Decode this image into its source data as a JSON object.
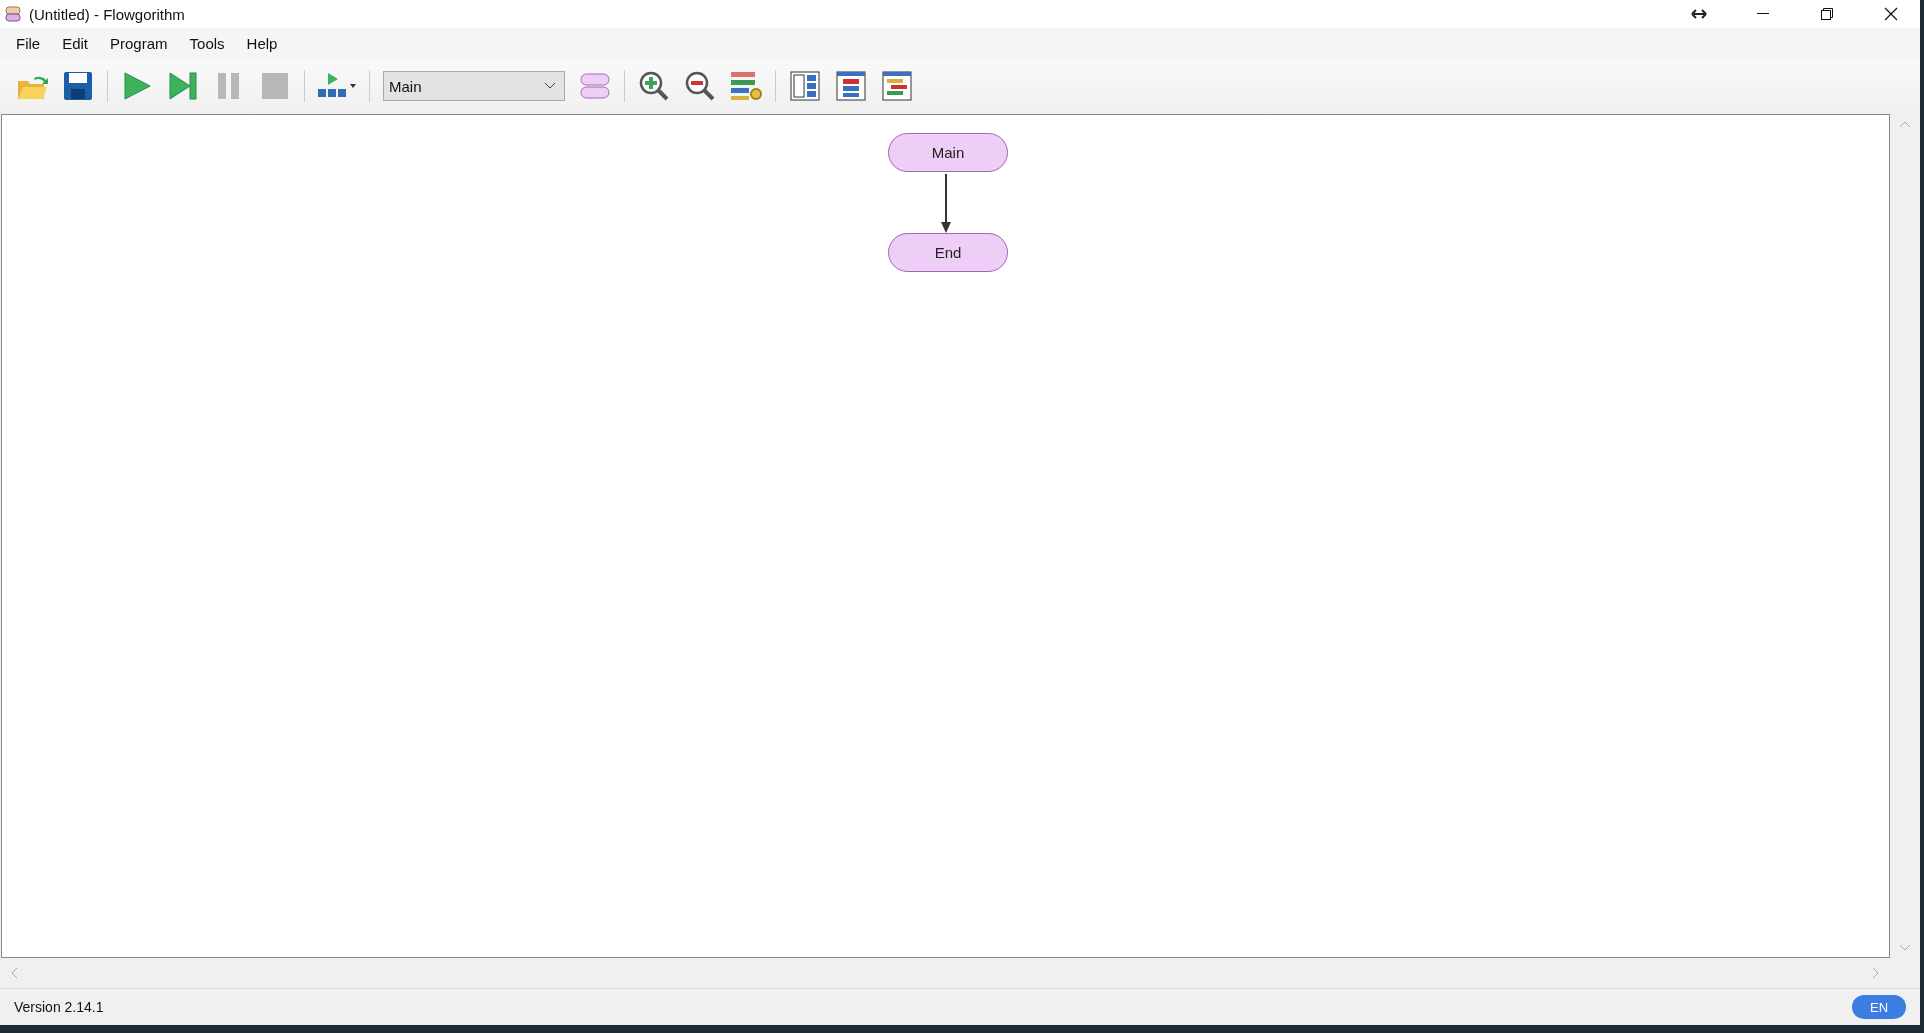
{
  "window": {
    "title": "(Untitled) - Flowgorithm"
  },
  "menu": [
    "File",
    "Edit",
    "Program",
    "Tools",
    "Help"
  ],
  "toolbar": {
    "function_select": "Main"
  },
  "flowchart": {
    "nodes": [
      {
        "label": "Main"
      },
      {
        "label": "End"
      }
    ]
  },
  "status_bar": {
    "version": "Version 2.14.1",
    "language": "EN"
  }
}
